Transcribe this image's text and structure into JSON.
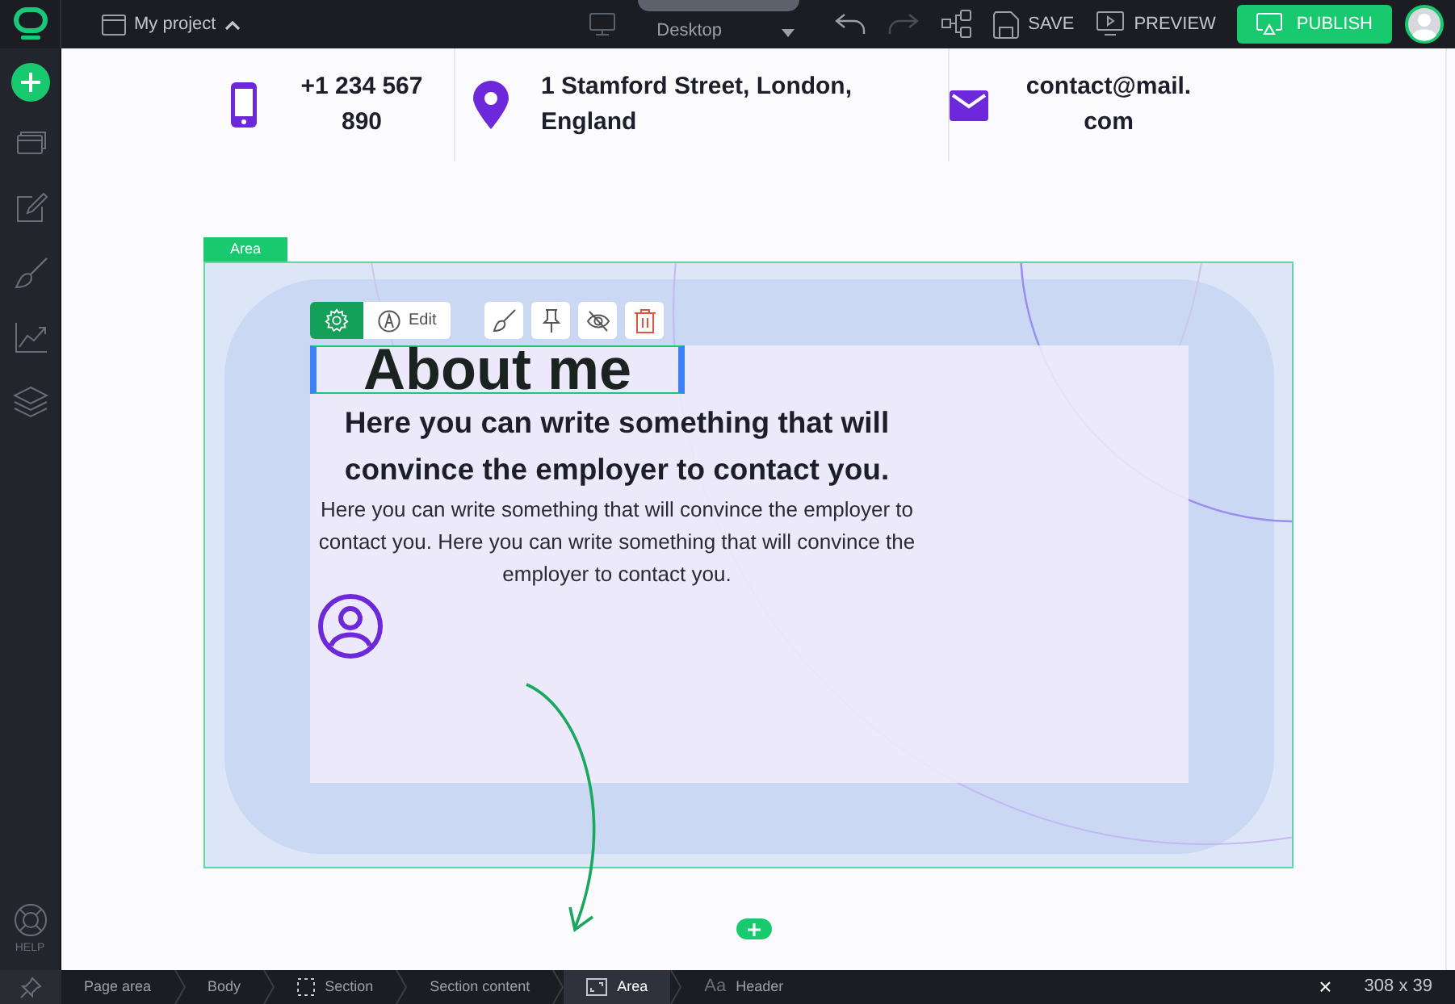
{
  "topbar": {
    "project": "My project",
    "device": "Desktop",
    "save": "SAVE",
    "preview": "PREVIEW",
    "publish": "PUBLISH"
  },
  "sidebar": {
    "help": "HELP"
  },
  "contacts": [
    {
      "kind": "phone",
      "text": "+1 234 567 890"
    },
    {
      "kind": "location",
      "text": "1 Stamford Street, London, England"
    },
    {
      "kind": "mail",
      "text": "contact@mail.com"
    }
  ],
  "area": {
    "label": "Area",
    "edit": "Edit",
    "heading": "About me",
    "subheading": "Here you can write something that will convince the employer to contact you.",
    "body": "Here you can write something that will convince the employer to contact you. Here you can write something that will convince the employer to contact you."
  },
  "breadcrumbs": [
    {
      "label": "Page area",
      "kind": "plain",
      "selected": false
    },
    {
      "label": "Body",
      "kind": "plain",
      "selected": false
    },
    {
      "label": "Section",
      "kind": "section",
      "selected": false
    },
    {
      "label": "Section content",
      "kind": "plain",
      "selected": false
    },
    {
      "label": "Area",
      "kind": "area",
      "selected": true
    },
    {
      "label": "Header",
      "kind": "text",
      "icon_text": "Aa",
      "selected": false
    }
  ],
  "status": {
    "close": "×",
    "size": "308 x 39"
  }
}
